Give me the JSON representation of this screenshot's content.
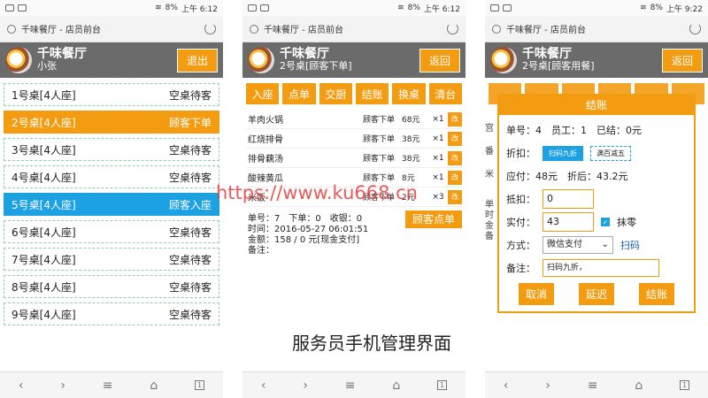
{
  "status": {
    "battery": "8%",
    "time1": "上午 6:12",
    "time3": "上午 9:22"
  },
  "url": "千味餐厅 - 店员前台",
  "restaurant": "千味餐厅",
  "screen1": {
    "user": "小张",
    "exit_label": "退出",
    "tables": [
      {
        "name": "1号桌[4人座]",
        "status": "空桌待客"
      },
      {
        "name": "2号桌[4人座]",
        "status": "顾客下单"
      },
      {
        "name": "3号桌[4人座]",
        "status": "空桌待客"
      },
      {
        "name": "4号桌[4人座]",
        "status": "空桌待客"
      },
      {
        "name": "5号桌[4人座]",
        "status": "顾客入座"
      },
      {
        "name": "6号桌[4人座]",
        "status": "空桌待客"
      },
      {
        "name": "7号桌[4人座]",
        "status": "空桌待客"
      },
      {
        "name": "8号桌[4人座]",
        "status": "空桌待客"
      },
      {
        "name": "9号桌[4人座]",
        "status": "空桌待客"
      }
    ]
  },
  "screen2": {
    "subtitle": "2号桌[顾客下单]",
    "back_label": "返回",
    "actions": [
      "入座",
      "点单",
      "交厨",
      "结账",
      "换桌",
      "清台"
    ],
    "orders": [
      {
        "name": "羊肉火锅",
        "status": "顾客下单",
        "price": "68元",
        "qty": "×1",
        "edit": "改"
      },
      {
        "name": "红烧排骨",
        "status": "顾客下单",
        "price": "38元",
        "qty": "×1",
        "edit": "改"
      },
      {
        "name": "排骨藕汤",
        "status": "顾客下单",
        "price": "38元",
        "qty": "×1",
        "edit": "改"
      },
      {
        "name": "酸辣黄瓜",
        "status": "顾客下单",
        "price": "8元",
        "qty": "×1",
        "edit": "改"
      },
      {
        "name": "米饭",
        "status": "顾客下单",
        "price": "2元",
        "qty": "×3",
        "edit": "改"
      }
    ],
    "summary_line1": "单号：7　下单：0　收银：0",
    "summary_line2": "时间：2016-05-27 06:01:51",
    "summary_line3": "金额：158 / 0 元[现金支付]",
    "summary_line4": "备注：",
    "customer_order_label": "顾客点单"
  },
  "screen3": {
    "subtitle": "2号桌[顾客用餐]",
    "back_label": "返回",
    "dialog": {
      "title": "结账",
      "line1": "单号：4　员工：1　已结：0元",
      "discount_label": "折扣：",
      "discount_options": [
        "扫码九折",
        "满百减五"
      ],
      "payable": "应付：48元　折后：43.2元",
      "deduct_label": "抵扣：",
      "deduct_value": "0",
      "paid_label": "实付：",
      "paid_value": "43",
      "round_label": "抹零",
      "method_label": "方式：",
      "method_value": "微信支付",
      "scan_label": "扫码",
      "note_label": "备注：",
      "note_value": "扫码九折，",
      "btn_cancel": "取消",
      "btn_delay": "延迟",
      "btn_checkout": "结账"
    },
    "behind_text": [
      "宫",
      "番",
      "米",
      "单",
      "时",
      "金",
      "备"
    ]
  },
  "caption": "服务员手机管理界面",
  "watermark": "https://www.ku668.cn"
}
